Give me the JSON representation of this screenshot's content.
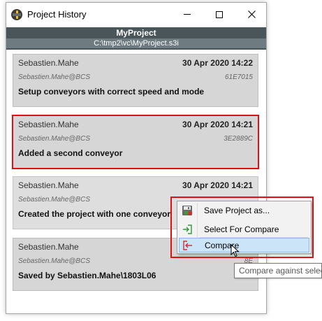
{
  "window": {
    "title": "Project History"
  },
  "project": {
    "name": "MyProject",
    "path": "C:\\tmp2\\vc\\MyProject.s3i"
  },
  "entries": [
    {
      "author": "Sebastien.Mahe",
      "date": "30 Apr 2020 14:22",
      "user": "Sebastien.Mahe@BCS",
      "hash": "61E7015",
      "message": "Setup conveyors with correct speed and mode"
    },
    {
      "author": "Sebastien.Mahe",
      "date": "30 Apr 2020 14:21",
      "user": "Sebastien.Mahe@BCS",
      "hash": "3E2889C",
      "message": "Added a second conveyor"
    },
    {
      "author": "Sebastien.Mahe",
      "date": "30 Apr 2020 14:21",
      "user": "Sebastien.Mahe@BCS",
      "hash": "",
      "message": "Created the project with one conveyor"
    },
    {
      "author": "Sebastien.Mahe",
      "date": "",
      "user": "Sebastien.Mahe@BCS",
      "hash": "8E",
      "message": "Saved by Sebastien.Mahe\\1803L06"
    }
  ],
  "context_menu": {
    "items": [
      {
        "label": "Save Project as...",
        "icon": "save-icon"
      },
      {
        "label": "Select For Compare",
        "icon": "select-compare-icon"
      },
      {
        "label": "Compare",
        "icon": "compare-icon"
      }
    ]
  },
  "tooltip": {
    "text": "Compare against select"
  },
  "colors": {
    "header_bg": "#4a5559",
    "card_bg": "#d6d6d6",
    "highlight_border": "#e01010",
    "menu_highlight": "#cce4f7"
  }
}
